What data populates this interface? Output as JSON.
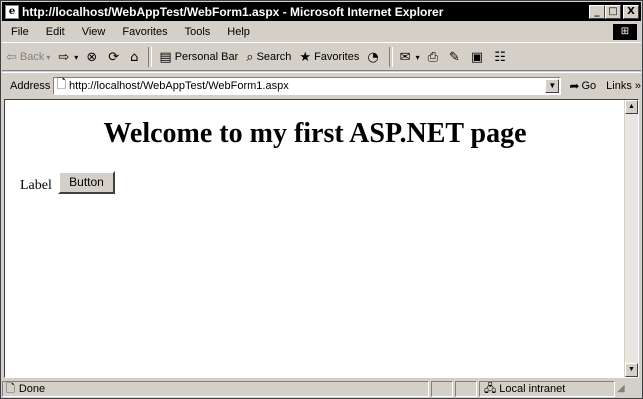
{
  "window": {
    "title": "http://localhost/WebAppTest/WebForm1.aspx - Microsoft Internet Explorer",
    "title_icon": "ie-page-icon",
    "minimize": "_",
    "maximize": "□",
    "close": "X"
  },
  "menu": [
    "File",
    "Edit",
    "View",
    "Favorites",
    "Tools",
    "Help"
  ],
  "toolbar": {
    "back": "Back",
    "personal_bar": "Personal Bar",
    "search": "Search",
    "favorites": "Favorites"
  },
  "address": {
    "label": "Address",
    "value": "http://localhost/WebAppTest/WebForm1.aspx",
    "go": "Go",
    "links": "Links »"
  },
  "page": {
    "heading": "Welcome to my first ASP.NET page",
    "label": "Label",
    "button": "Button"
  },
  "status": {
    "text": "Done",
    "zone": "Local intranet"
  },
  "colors": {
    "chrome": "#d4d0c8",
    "titlebar": "#000000",
    "content_bg": "#ffffff"
  }
}
